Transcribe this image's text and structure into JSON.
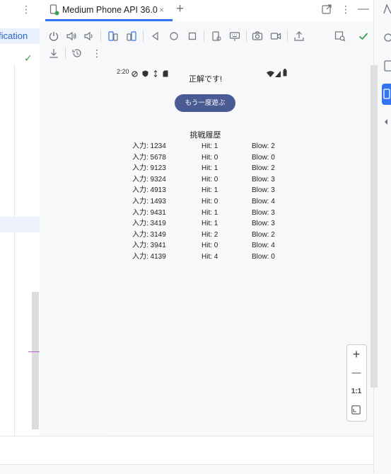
{
  "left_panel": {
    "more_label": "⋮",
    "notification_text": "fication",
    "check_label": "✓"
  },
  "tab": {
    "label": "Medium Phone API 36.0",
    "close_label": "×",
    "add_label": "+"
  },
  "window_controls": {
    "more_label": "⋮",
    "minimize_label": "—"
  },
  "toolbar": {
    "more_label": "⋮"
  },
  "device": {
    "status_time": "2:20",
    "message": "正解です!",
    "retry_button": "もう一度遊ぶ",
    "history_title": "挑戦履歴",
    "history": [
      {
        "input": "入力: 1234",
        "hit": "Hit: 1",
        "blow": "Blow: 2"
      },
      {
        "input": "入力: 5678",
        "hit": "Hit: 0",
        "blow": "Blow: 0"
      },
      {
        "input": "入力: 9123",
        "hit": "Hit: 1",
        "blow": "Blow: 2"
      },
      {
        "input": "入力: 9324",
        "hit": "Hit: 0",
        "blow": "Blow: 3"
      },
      {
        "input": "入力: 4913",
        "hit": "Hit: 1",
        "blow": "Blow: 3"
      },
      {
        "input": "入力: 1493",
        "hit": "Hit: 0",
        "blow": "Blow: 4"
      },
      {
        "input": "入力: 9431",
        "hit": "Hit: 1",
        "blow": "Blow: 3"
      },
      {
        "input": "入力: 3419",
        "hit": "Hit: 1",
        "blow": "Blow: 3"
      },
      {
        "input": "入力: 3149",
        "hit": "Hit: 2",
        "blow": "Blow: 2"
      },
      {
        "input": "入力: 3941",
        "hit": "Hit: 0",
        "blow": "Blow: 4"
      },
      {
        "input": "入力: 4139",
        "hit": "Hit: 4",
        "blow": "Blow: 0"
      }
    ]
  },
  "zoom": {
    "zoom_in": "+",
    "zoom_out": "—",
    "actual_size": "1:1"
  },
  "colors": {
    "accent": "#3574f0",
    "button": "#4a5a93",
    "check": "#3d9f52"
  }
}
